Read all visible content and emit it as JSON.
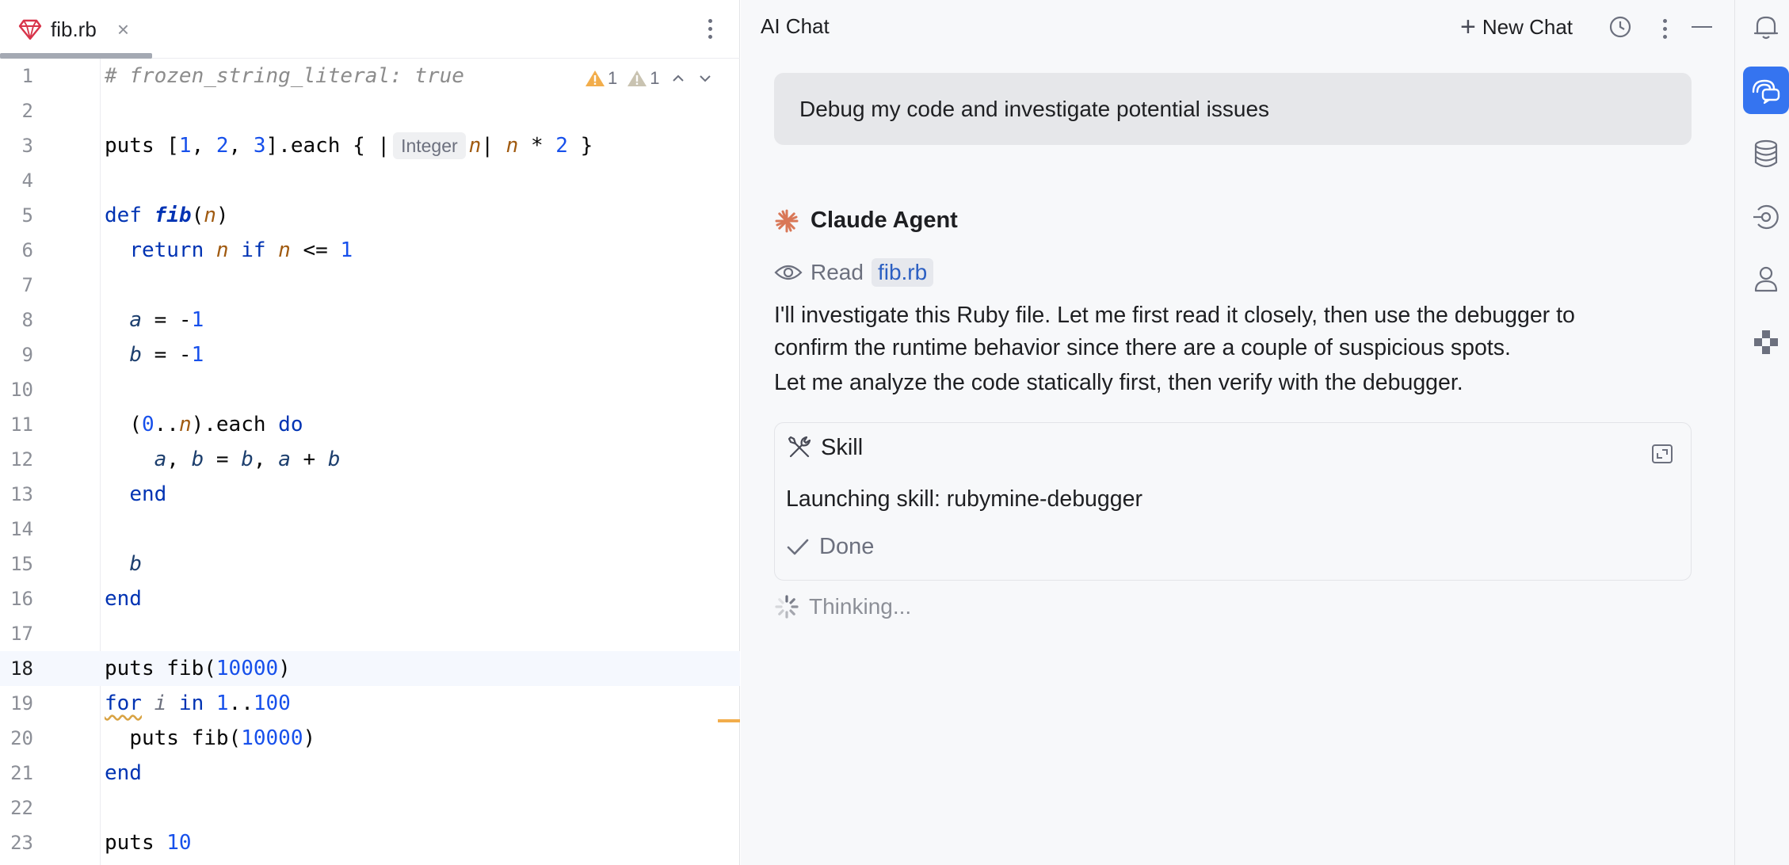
{
  "editor": {
    "tab": {
      "title": "fib.rb",
      "close_glyph": "×"
    },
    "inspection": {
      "warnings_a": "1",
      "warnings_b": "1"
    },
    "lines": [
      {
        "n": "1"
      },
      {
        "n": "2"
      },
      {
        "n": "3"
      },
      {
        "n": "4"
      },
      {
        "n": "5"
      },
      {
        "n": "6"
      },
      {
        "n": "7"
      },
      {
        "n": "8"
      },
      {
        "n": "9"
      },
      {
        "n": "10"
      },
      {
        "n": "11"
      },
      {
        "n": "12"
      },
      {
        "n": "13"
      },
      {
        "n": "14"
      },
      {
        "n": "15"
      },
      {
        "n": "16"
      },
      {
        "n": "17"
      },
      {
        "n": "18"
      },
      {
        "n": "19"
      },
      {
        "n": "20"
      },
      {
        "n": "21"
      },
      {
        "n": "22"
      },
      {
        "n": "23"
      }
    ],
    "code": {
      "l1": "# frozen_string_literal: true",
      "l3": {
        "puts": "puts [",
        "n1": "1",
        "c1": ", ",
        "n2": "2",
        "c2": ", ",
        "n3": "3",
        "each": "].each { |",
        "hint": "Integer",
        "p": "n",
        "bar": "| ",
        "p2": "n",
        "mul": " * ",
        "two": "2",
        "end": " }"
      },
      "l5": {
        "def": "def ",
        "name": "fib",
        "open": "(",
        "p": "n",
        "close": ")"
      },
      "l6": {
        "ret": "return ",
        "p": "n",
        "if": " if ",
        "p2": "n",
        "le": " <= ",
        "one": "1"
      },
      "l8": {
        "v": "a",
        "eq": " = -",
        "num": "1"
      },
      "l9": {
        "v": "b",
        "eq": " = -",
        "num": "1"
      },
      "l11": {
        "open": "(",
        "zero": "0",
        "dots": "..",
        "p": "n",
        "each": ").each ",
        "do": "do"
      },
      "l12": {
        "a": "a",
        "c1": ", ",
        "b": "b",
        "eq": " = ",
        "b2": "b",
        "c2": ", ",
        "a2": "a",
        "plus": " + ",
        "b3": "b"
      },
      "l13": "end",
      "l15": "b",
      "l16": "end",
      "l18": {
        "puts": "puts fib(",
        "num": "10000",
        "close": ")"
      },
      "l19": {
        "for": "for",
        "sp": " ",
        "i": "i",
        "in": " in ",
        "one": "1",
        "dots": "..",
        "hundred": "100"
      },
      "l20": {
        "puts": "puts fib(",
        "num": "10000",
        "close": ")"
      },
      "l21": "end",
      "l23": {
        "puts": "puts ",
        "num": "10"
      }
    }
  },
  "chat": {
    "title": "AI Chat",
    "new_chat_label": "New Chat",
    "user_message": "Debug my code and investigate potential issues",
    "agent_name": "Claude Agent",
    "read_label": "Read",
    "read_file": "fib.rb",
    "paragraph_1a": "I'll investigate this Ruby file. Let me first read it closely, then use the debugger to",
    "paragraph_1b": "confirm the runtime behavior since there are a couple of suspicious spots.",
    "paragraph_2": "Let me analyze the code statically first, then verify with the debugger.",
    "skill": {
      "title": "Skill",
      "text": "Launching skill: rubymine-debugger",
      "status": "Done"
    },
    "thinking": "Thinking..."
  },
  "colors": {
    "accent": "#3574f0",
    "agent_star": "#d97757",
    "warning": "#f2ad4b",
    "ruby": "#d8344a"
  },
  "icons": {
    "tab": "ruby-icon",
    "strip": [
      "notifications-icon",
      "ai-chat-icon",
      "database-icon",
      "endpoints-icon",
      "user-icon",
      "plugin-icon"
    ]
  }
}
